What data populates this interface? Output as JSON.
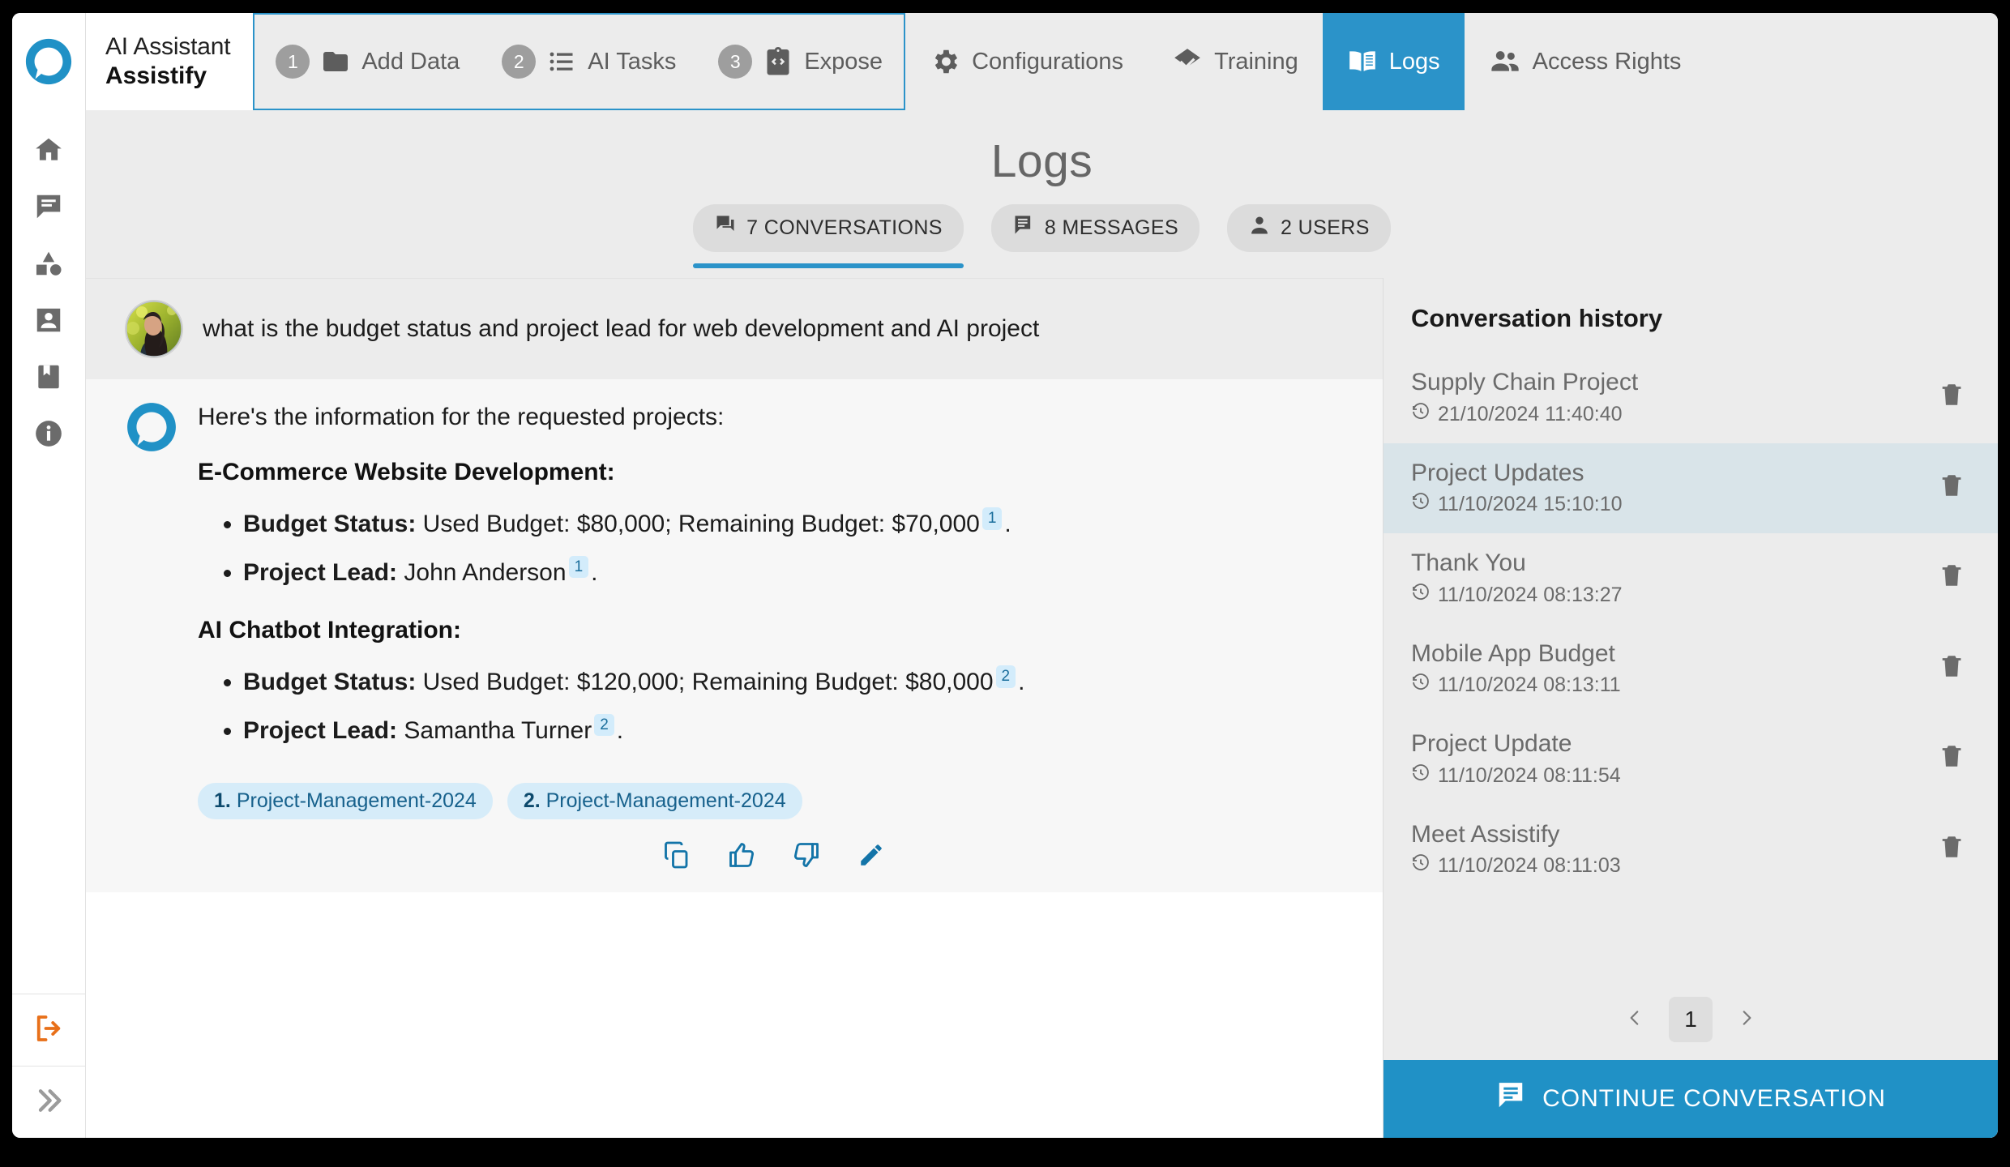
{
  "app": {
    "brand_line1": "AI Assistant",
    "brand_line2": "Assistify",
    "logo_icon": "assistify-speech-bubble-logo"
  },
  "topnav": {
    "steps": [
      {
        "number": "1",
        "label": "Add Data",
        "icon": "folder-icon"
      },
      {
        "number": "2",
        "label": "AI Tasks",
        "icon": "list-icon"
      },
      {
        "number": "3",
        "label": "Expose",
        "icon": "code-clipboard-icon"
      }
    ],
    "items": [
      {
        "label": "Configurations",
        "icon": "gear-icon",
        "active": false
      },
      {
        "label": "Training",
        "icon": "layers-check-icon",
        "active": false
      },
      {
        "label": "Logs",
        "icon": "book-icon",
        "active": true
      },
      {
        "label": "Access Rights",
        "icon": "people-icon",
        "active": false
      }
    ]
  },
  "rail": {
    "items": [
      {
        "name": "home-icon"
      },
      {
        "name": "chat-icon"
      },
      {
        "name": "shapes-icon"
      },
      {
        "name": "account-box-icon"
      },
      {
        "name": "book-bookmark-icon"
      },
      {
        "name": "info-icon"
      }
    ],
    "logout_icon": "logout-icon",
    "expand_icon": "double-chevron-right-icon"
  },
  "main": {
    "page_title": "Logs",
    "tabs": [
      {
        "label": "7 CONVERSATIONS",
        "icon": "conversations-icon",
        "active": true
      },
      {
        "label": "8 MESSAGES",
        "icon": "messages-icon",
        "active": false
      },
      {
        "label": "2 USERS",
        "icon": "user-icon",
        "active": false
      }
    ]
  },
  "chat": {
    "user_message": "what is the budget status and project lead for web development and AI project",
    "bot_intro": "Here's the information for the requested projects:",
    "sections": [
      {
        "heading": "E-Commerce Website Development:",
        "bullets": [
          {
            "label": "Budget Status:",
            "text": " Used Budget: $80,000; Remaining Budget: $70,000",
            "cite": "1"
          },
          {
            "label": "Project Lead:",
            "text": " John Anderson",
            "cite": "1"
          }
        ]
      },
      {
        "heading": "AI Chatbot Integration:",
        "bullets": [
          {
            "label": "Budget Status:",
            "text": " Used Budget: $120,000; Remaining Budget: $80,000",
            "cite": "2"
          },
          {
            "label": "Project Lead:",
            "text": " Samantha Turner",
            "cite": "2"
          }
        ]
      }
    ],
    "sources": [
      {
        "num": "1.",
        "name": "Project-Management-2024"
      },
      {
        "num": "2.",
        "name": "Project-Management-2024"
      }
    ],
    "actions": [
      {
        "name": "copy-icon"
      },
      {
        "name": "thumbs-up-icon"
      },
      {
        "name": "thumbs-down-icon"
      },
      {
        "name": "edit-icon"
      }
    ]
  },
  "history": {
    "title": "Conversation history",
    "items": [
      {
        "name": "Supply Chain Project",
        "date": "21/10/2024 11:40:40",
        "selected": false
      },
      {
        "name": "Project Updates",
        "date": "11/10/2024 15:10:10",
        "selected": true
      },
      {
        "name": "Thank You",
        "date": "11/10/2024 08:13:27",
        "selected": false
      },
      {
        "name": "Mobile App Budget",
        "date": "11/10/2024 08:13:11",
        "selected": false
      },
      {
        "name": "Project Update",
        "date": "11/10/2024 08:11:54",
        "selected": false
      },
      {
        "name": "Meet Assistify",
        "date": "11/10/2024 08:11:03",
        "selected": false
      }
    ],
    "pagination": {
      "prev_icon": "chevron-left-icon",
      "page": "1",
      "next_icon": "chevron-right-icon"
    },
    "continue_label": "CONTINUE CONVERSATION",
    "continue_icon": "chat-icon"
  },
  "colors": {
    "accent": "#2b93c9",
    "continue_button": "#2091c6",
    "citation_bg": "#d3ecfb",
    "logout": "#e8701a",
    "selected_row": "#d9e4e9"
  }
}
